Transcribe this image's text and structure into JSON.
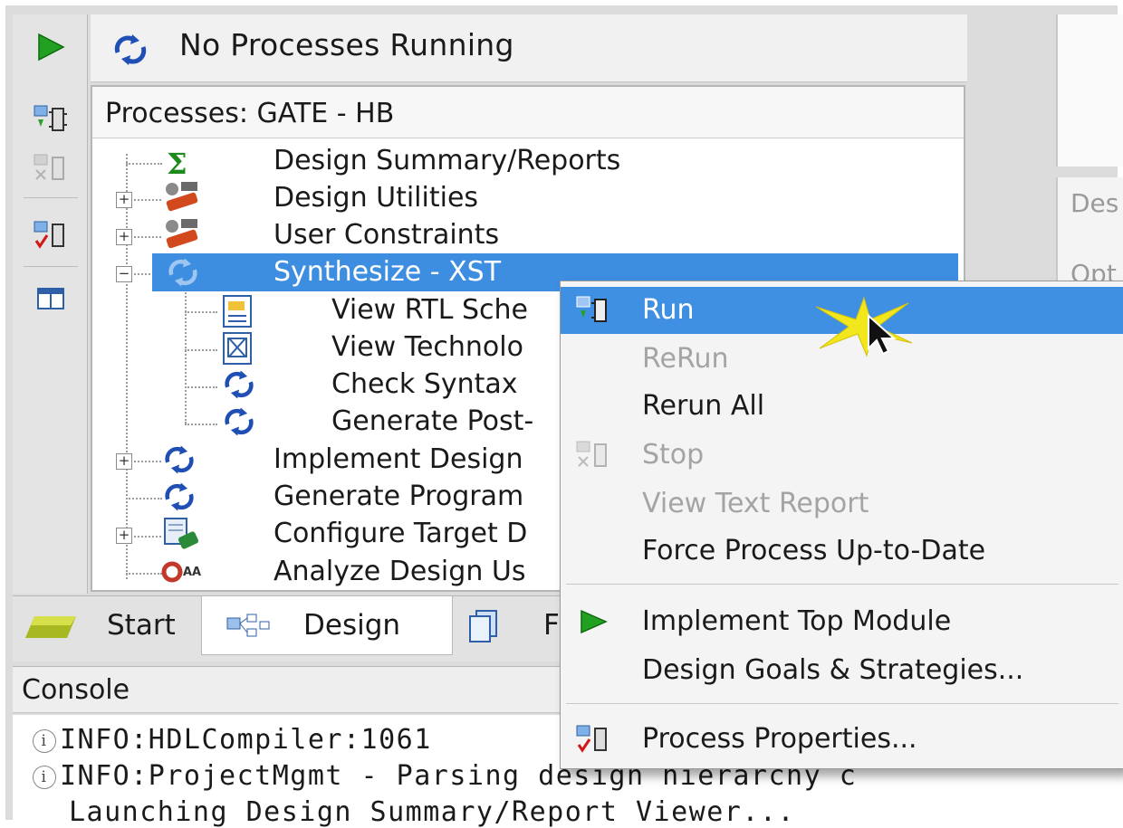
{
  "status": {
    "text": "No Processes Running"
  },
  "processes": {
    "header": "Processes: GATE - HB",
    "items": [
      {
        "label": "Design Summary/Reports"
      },
      {
        "label": "Design Utilities"
      },
      {
        "label": "User Constraints"
      },
      {
        "label": "Synthesize - XST"
      },
      {
        "label": "View RTL Sche"
      },
      {
        "label": "View Technolo"
      },
      {
        "label": "Check Syntax"
      },
      {
        "label": "Generate Post-"
      },
      {
        "label": "Implement Design"
      },
      {
        "label": "Generate Program"
      },
      {
        "label": "Configure Target D"
      },
      {
        "label": "Analyze Design Us"
      }
    ]
  },
  "tabs": [
    {
      "label": "Start"
    },
    {
      "label": "Design"
    },
    {
      "label": "F"
    }
  ],
  "console": {
    "title": "Console",
    "lines": [
      "INFO:HDLCompiler:1061",
      "INFO:ProjectMgmt - Parsing design hierarchy c",
      "Launching Design Summary/Report Viewer..."
    ]
  },
  "right_panel": {
    "label1": "Des",
    "label2": "Opt"
  },
  "context_menu": {
    "items": [
      {
        "label": "Run",
        "state": "highlighted",
        "icon": "run-process-icon"
      },
      {
        "label": "ReRun",
        "state": "disabled"
      },
      {
        "label": "Rerun All",
        "state": "enabled"
      },
      {
        "label": "Stop",
        "state": "disabled",
        "icon": "stop-process-icon"
      },
      {
        "label": "View Text Report",
        "state": "disabled"
      },
      {
        "label": "Force Process Up-to-Date",
        "state": "enabled"
      },
      {
        "label": "Implement Top Module",
        "state": "enabled",
        "icon": "green-play-icon"
      },
      {
        "label": "Design Goals & Strategies...",
        "state": "enabled"
      },
      {
        "label": "Process Properties...",
        "state": "enabled",
        "icon": "process-properties-icon"
      }
    ]
  },
  "colors": {
    "selection": "#3d8ee0",
    "menu_highlight": "#3f8fe2",
    "play_green": "#2a9a2a",
    "refresh_blue": "#1f4fb5"
  }
}
